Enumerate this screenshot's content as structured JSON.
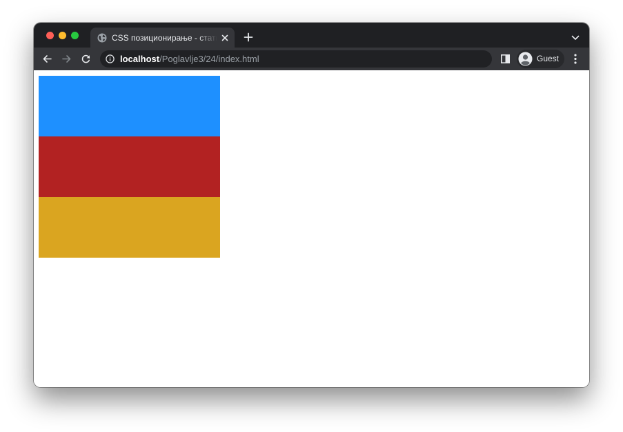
{
  "tab": {
    "title": "CSS позиционирање - статичко",
    "favicon": "globe-icon"
  },
  "address_bar": {
    "host": "localhost",
    "path": "/Poglavlje3/24/index.html",
    "security_icon": "info-icon"
  },
  "profile": {
    "name": "Guest",
    "icon": "avatar-icon"
  },
  "toolbar_icons": [
    "back-arrow-icon",
    "forward-arrow-icon",
    "reload-icon",
    "side-panel-icon",
    "kebab-menu-icon"
  ],
  "page": {
    "boxes": [
      {
        "color": "#1e90ff"
      },
      {
        "color": "#b22222"
      },
      {
        "color": "#daa520"
      }
    ]
  }
}
